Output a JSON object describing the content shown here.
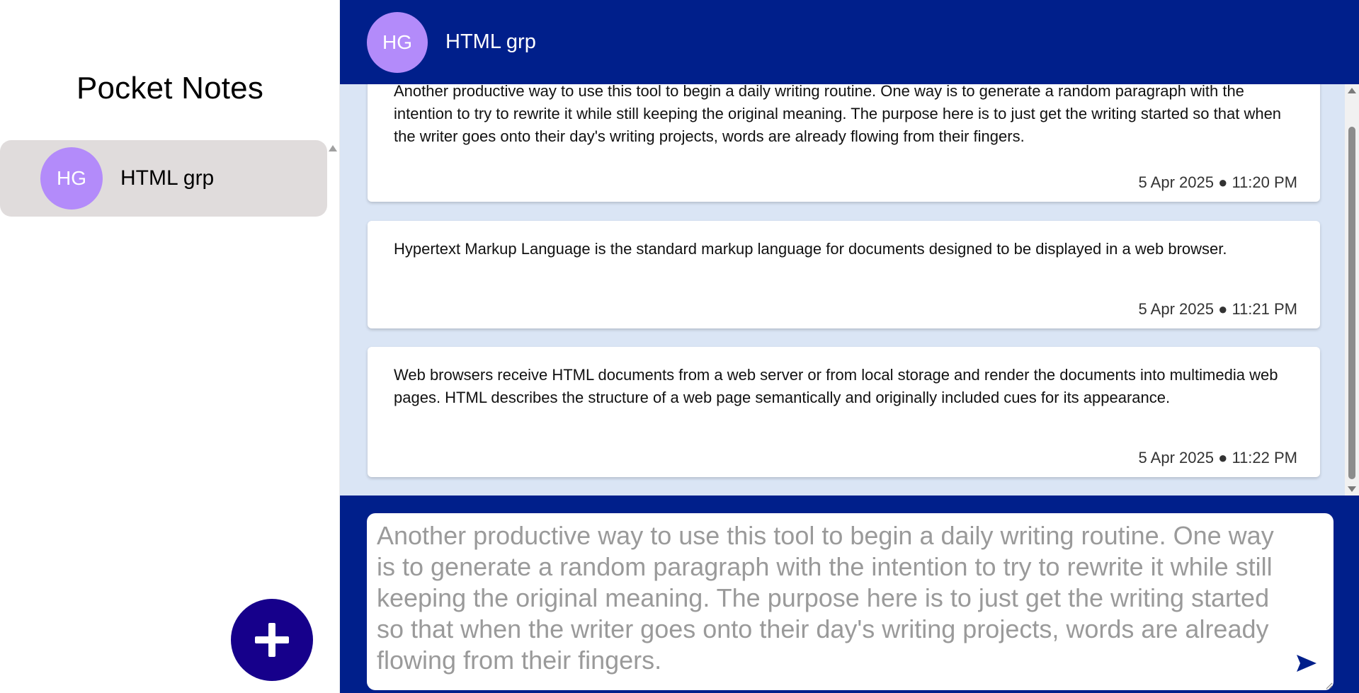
{
  "sidebar": {
    "title": "Pocket Notes",
    "groups": [
      {
        "initials": "HG",
        "name": "HTML grp",
        "avatar_color": "#b38bfa",
        "selected": true
      }
    ],
    "add_button_icon": "plus-icon",
    "add_button_color": "#16008b"
  },
  "header": {
    "initials": "HG",
    "title": "HTML grp",
    "background": "#001f8b"
  },
  "notes": [
    {
      "text": "Another productive way to use this tool to begin a daily writing routine. One way is to generate a random paragraph with the intention to try to rewrite it while still keeping the original meaning. The purpose here is to just get the writing started so that when the writer goes onto their day's writing projects, words are already flowing from their fingers.",
      "meta": "5 Apr 2025 ● 11:20 PM"
    },
    {
      "text": "Hypertext Markup Language is the standard markup language for documents designed to be displayed in a web browser.",
      "meta": "5 Apr 2025 ● 11:21 PM"
    },
    {
      "text": "Web browsers receive HTML documents from a web server or from local storage and render the documents into multimedia web pages. HTML describes the structure of a web page semantically and originally included cues for its appearance.",
      "meta": "5 Apr 2025 ● 11:22 PM"
    }
  ],
  "composer": {
    "value": "",
    "placeholder": "Another productive way to use this tool to begin a daily writing routine. One way is to generate a random paragraph with the intention to try to rewrite it while still keeping the original meaning. The purpose here is to just get the writing started so that when the writer goes onto their day's writing projects, words are already flowing from their fingers.",
    "send_icon": "send-arrow-icon"
  }
}
